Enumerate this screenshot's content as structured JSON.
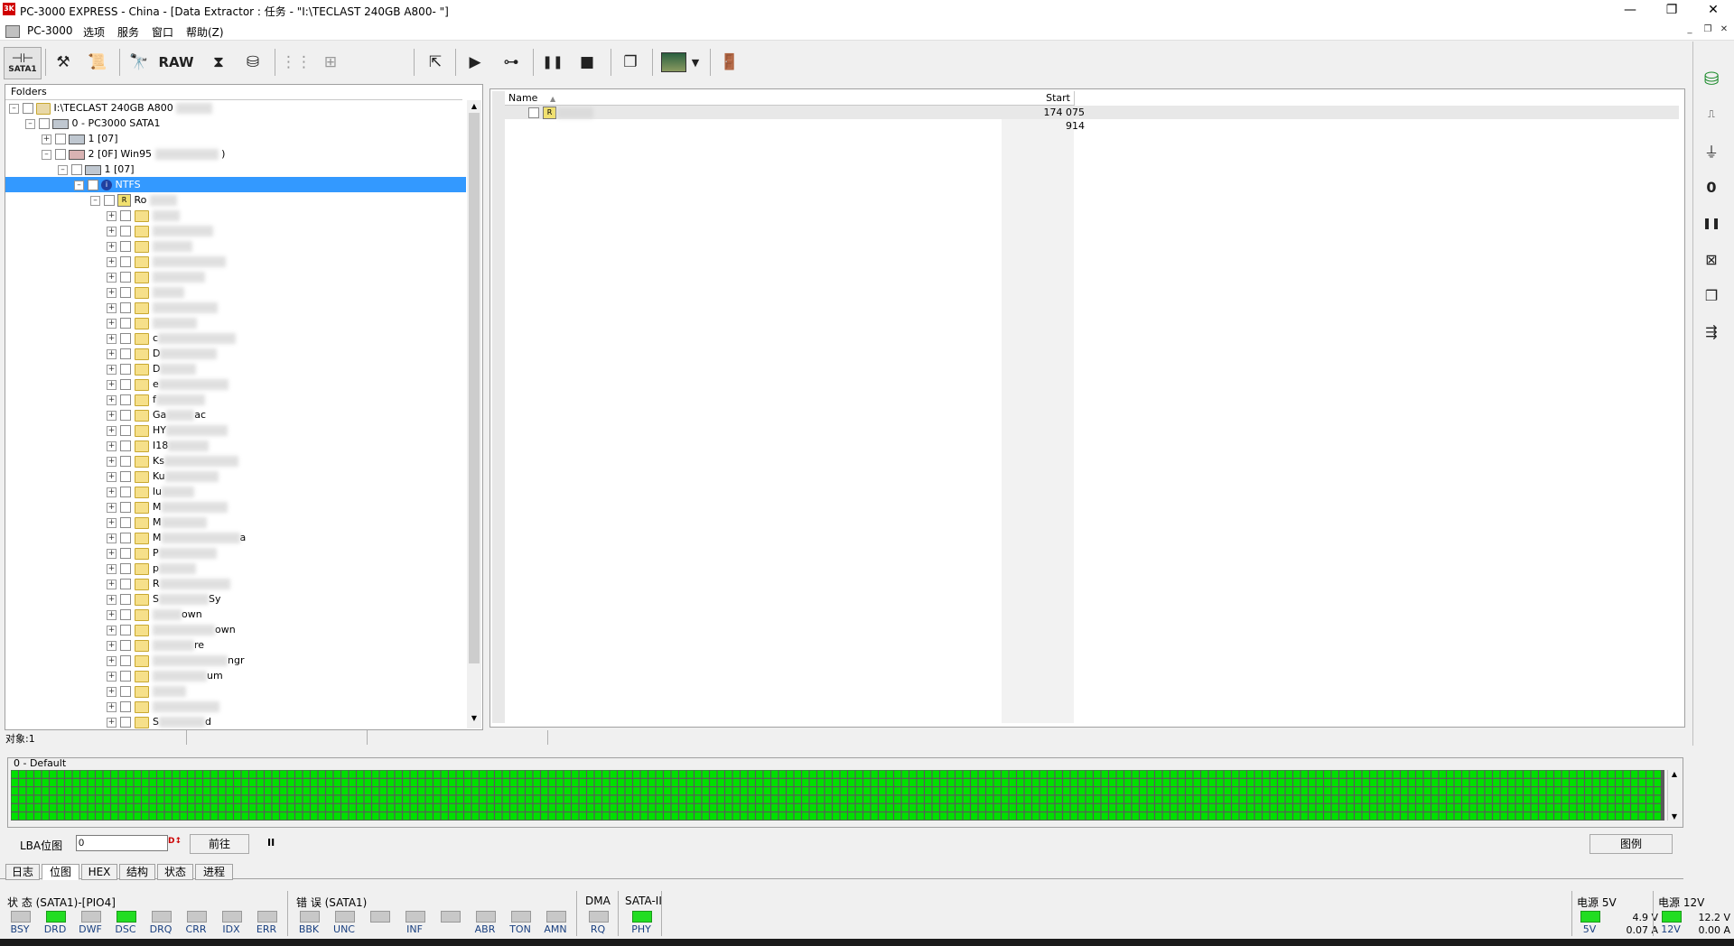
{
  "window": {
    "title": "PC-3000 EXPRESS - China - [Data Extractor : 任务 - \"I:\\TECLAST 240GB A800-          \"]",
    "logo_text": "3K",
    "minimize": "—",
    "restore": "❐",
    "close": "✕"
  },
  "menu": {
    "items": [
      "PC-3000",
      "选项",
      "服务",
      "窗口",
      "帮助(Z)"
    ],
    "mdi_minimize": "_",
    "mdi_restore": "❐",
    "mdi_close": "✕"
  },
  "toolbar": {
    "sata_label": "SATA1",
    "raw_label": "RAW"
  },
  "tree": {
    "header": "Folders",
    "root_label": "I:\\TECLAST 240GB A800",
    "pc3000_label": "0 - PC3000 SATA1",
    "part1_label": "1 [07]",
    "part2_label": "2 [0F] Win95",
    "part2_suffix": ")",
    "sub1_label": "1 [07]",
    "ntfs_label": "NTFS",
    "ntfs_icon": "i",
    "rootdir_label": "Ro",
    "root_icon": "R",
    "folder_texts": [
      "",
      "",
      "",
      "",
      "",
      "",
      "",
      "",
      "c",
      "D",
      "D",
      "e",
      "f",
      "Ga",
      "HY",
      "I18",
      "Ks",
      "Ku",
      "lu",
      "M",
      "M",
      "M",
      "P",
      "p",
      "R",
      "S",
      "",
      "",
      "",
      "",
      "",
      "",
      "",
      "S"
    ],
    "folder_suffix_texts": [
      "",
      "",
      "",
      "",
      "",
      "",
      "",
      "",
      "",
      "",
      "",
      "",
      "",
      "ac",
      "",
      "",
      "",
      "",
      "",
      "",
      "",
      "a",
      "",
      "",
      "",
      "Sy",
      "own",
      "own",
      "re",
      "ngr",
      "um",
      "",
      "",
      "d"
    ]
  },
  "filelist": {
    "col_name": "Name",
    "col_start": "Start",
    "rows": [
      {
        "name": "",
        "start": "174 075 914",
        "icon": "R"
      }
    ]
  },
  "status": {
    "objects": "对象:1"
  },
  "map": {
    "group_title": "0 - Default",
    "cell_color": "#00e000",
    "lba_label": "LBA位图",
    "lba_value": "0",
    "go_button": "前往",
    "pause_button": "II",
    "legend_button": "图例"
  },
  "tabs": [
    "日志",
    "位图",
    "HEX",
    "结构",
    "状态",
    "进程"
  ],
  "active_tab": "位图",
  "indicators": {
    "status_title": "状 态 (SATA1)-[PIO4]",
    "status": [
      {
        "label": "BSY",
        "on": false
      },
      {
        "label": "DRD",
        "on": true
      },
      {
        "label": "DWF",
        "on": false
      },
      {
        "label": "DSC",
        "on": true
      },
      {
        "label": "DRQ",
        "on": false
      },
      {
        "label": "CRR",
        "on": false
      },
      {
        "label": "IDX",
        "on": false
      },
      {
        "label": "ERR",
        "on": false
      }
    ],
    "error_title": "错 误 (SATA1)",
    "errors": [
      {
        "label": "BBK",
        "on": false
      },
      {
        "label": "UNC",
        "on": false
      },
      {
        "label": "",
        "on": false
      },
      {
        "label": "INF",
        "on": false
      },
      {
        "label": "",
        "on": false
      },
      {
        "label": "ABR",
        "on": false
      },
      {
        "label": "TON",
        "on": false
      },
      {
        "label": "AMN",
        "on": false
      }
    ],
    "dma_title": "DMA",
    "dma": {
      "label": "RQ",
      "on": false
    },
    "sata_title": "SATA-II",
    "sata": {
      "label": "PHY",
      "on": true
    },
    "power5_title": "电源 5V",
    "power5_label": "5V",
    "power5_volt": "4.9 V",
    "power5_amp": "0.07 A",
    "power12_title": "电源 12V",
    "power12_label": "12V",
    "power12_volt": "12.2 V",
    "power12_amp": "0.00 A"
  },
  "colors": {
    "selection": "#3399ff",
    "lamp_on": "#22dd22",
    "lamp_off": "#c8c8c8"
  }
}
